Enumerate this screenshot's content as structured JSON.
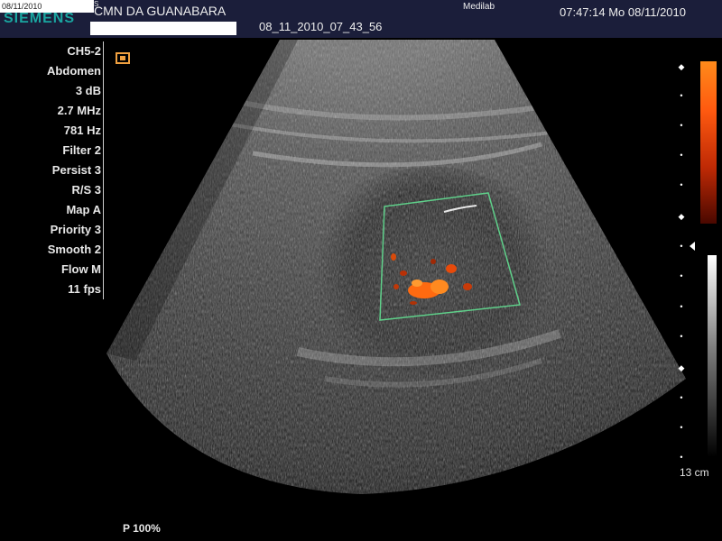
{
  "header": {
    "logo_date": "08/11/2010",
    "logo_brand": "SIEMENS",
    "logo_mark": "S",
    "hospital": "CMN DA GUANABARA",
    "study_id": "08_11_2010_07_43_56",
    "vendor": "Medilab",
    "datetime": "07:47:14  Mo  08/11/2010"
  },
  "params": [
    "CH5-2",
    "Abdomen",
    "3 dB",
    "2.7 MHz",
    "781 Hz",
    "Filter 2",
    "Persist 3",
    "R/S 3",
    "Map A",
    "Priority 3",
    "Smooth 2",
    "Flow M",
    "11 fps"
  ],
  "depth_scale": {
    "label": "13 cm"
  },
  "power_label": "P 100%",
  "colors": {
    "header_bg": "#1b1e3a",
    "roi_box": "#5fd08a",
    "doppler": "#ff6a10",
    "brand": "#1aa5a0"
  }
}
